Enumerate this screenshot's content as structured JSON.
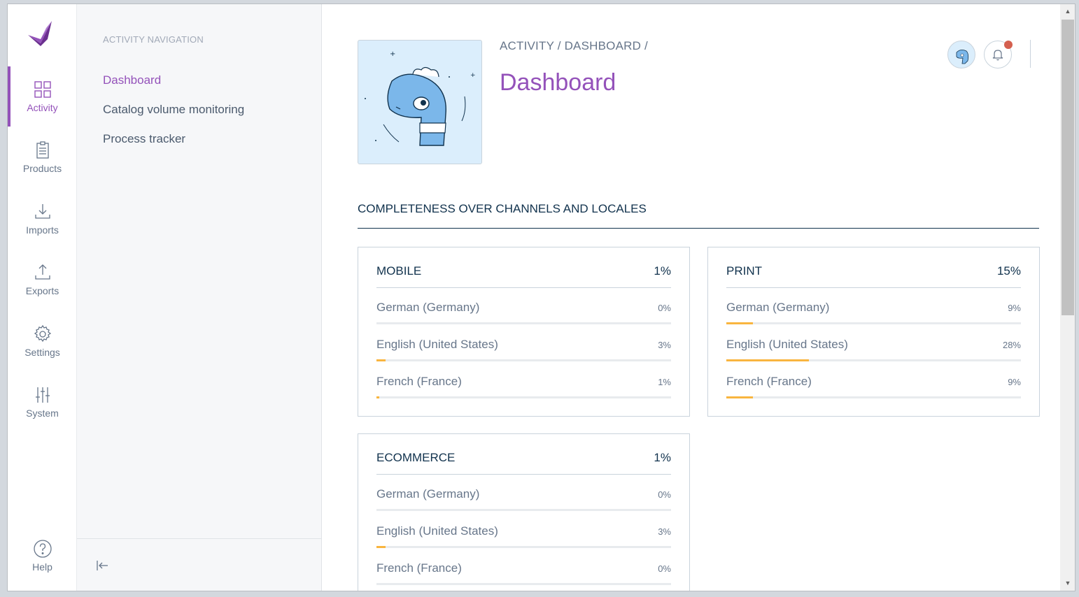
{
  "menu": {
    "items": [
      {
        "label": "Activity",
        "icon": "dashboard-grid-icon",
        "active": true
      },
      {
        "label": "Products",
        "icon": "clipboard-list-icon"
      },
      {
        "label": "Imports",
        "icon": "import-download-icon"
      },
      {
        "label": "Exports",
        "icon": "export-upload-icon"
      },
      {
        "label": "Settings",
        "icon": "gear-icon"
      },
      {
        "label": "System",
        "icon": "sliders-icon"
      }
    ],
    "help_label": "Help"
  },
  "subnav": {
    "title": "ACTIVITY NAVIGATION",
    "items": [
      {
        "label": "Dashboard",
        "active": true
      },
      {
        "label": "Catalog volume monitoring"
      },
      {
        "label": "Process tracker"
      }
    ]
  },
  "header": {
    "breadcrumb": "ACTIVITY / DASHBOARD /",
    "title": "Dashboard",
    "has_notification": true
  },
  "completeness": {
    "title": "COMPLETENESS OVER CHANNELS AND LOCALES",
    "channels": [
      {
        "name": "MOBILE",
        "percent": "1%",
        "locales": [
          {
            "name": "German (Germany)",
            "percent": "0%",
            "value": 0
          },
          {
            "name": "English (United States)",
            "percent": "3%",
            "value": 3
          },
          {
            "name": "French (France)",
            "percent": "1%",
            "value": 1
          }
        ]
      },
      {
        "name": "PRINT",
        "percent": "15%",
        "locales": [
          {
            "name": "German (Germany)",
            "percent": "9%",
            "value": 9
          },
          {
            "name": "English (United States)",
            "percent": "28%",
            "value": 28
          },
          {
            "name": "French (France)",
            "percent": "9%",
            "value": 9
          }
        ]
      },
      {
        "name": "ECOMMERCE",
        "percent": "1%",
        "locales": [
          {
            "name": "German (Germany)",
            "percent": "0%",
            "value": 0
          },
          {
            "name": "English (United States)",
            "percent": "3%",
            "value": 3
          },
          {
            "name": "French (France)",
            "percent": "0%",
            "value": 0
          }
        ]
      }
    ]
  },
  "colors": {
    "brand": "#9452ba",
    "progress": "#f9b53f",
    "notification": "#d4604f"
  }
}
